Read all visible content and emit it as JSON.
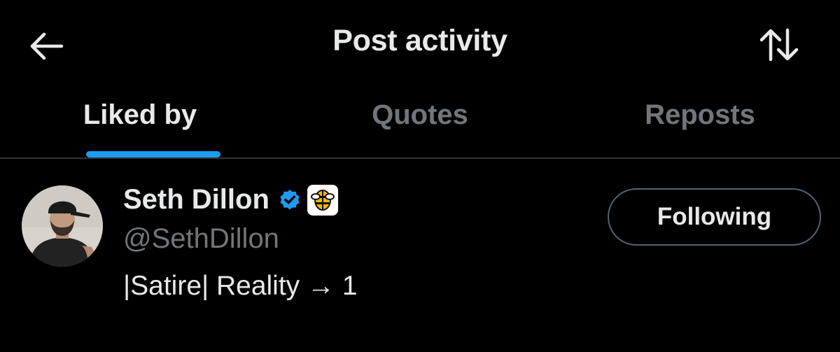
{
  "header": {
    "title": "Post activity",
    "back_icon": "arrow-left-icon",
    "sort_icon": "sort-arrows-icon"
  },
  "tabs": [
    {
      "label": "Liked by",
      "active": true
    },
    {
      "label": "Quotes",
      "active": false
    },
    {
      "label": "Reposts",
      "active": false
    }
  ],
  "user": {
    "name": "Seth Dillon",
    "handle": "@SethDillon",
    "bio": "|Satire| Reality → 1",
    "verified_icon": "verified-badge-icon",
    "affiliate_icon": "babylon-bee-logo-icon",
    "follow_label": "Following"
  },
  "colors": {
    "background": "#000000",
    "text": "#e7e9ea",
    "muted": "#71767b",
    "accent": "#1d9bf0",
    "divider": "#2f3336"
  }
}
